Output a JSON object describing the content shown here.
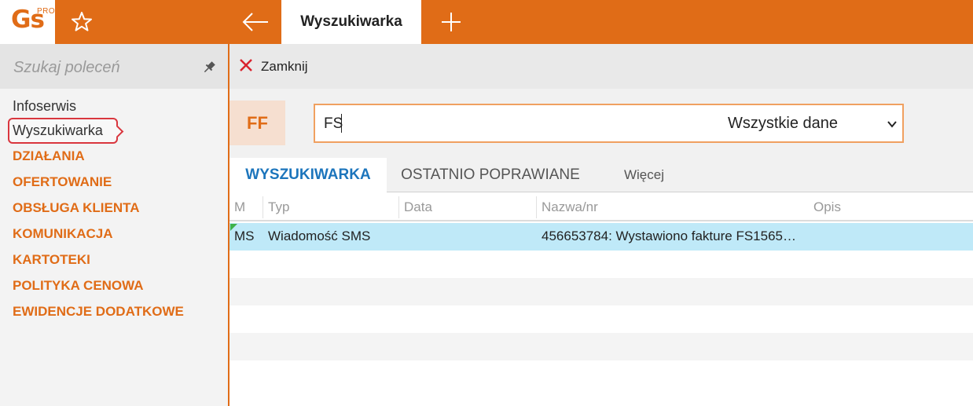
{
  "topbar": {
    "logo_text": "Gs",
    "logo_superscript": "PRO",
    "active_tab": "Wyszukiwarka",
    "accent_color": "#e06c17"
  },
  "sidebar": {
    "search_placeholder": "Szukaj poleceń",
    "items": [
      {
        "label": "Infoserwis"
      },
      {
        "label": "Wyszukiwarka"
      }
    ],
    "categories": [
      {
        "label": "DZIAŁANIA"
      },
      {
        "label": "OFERTOWANIE"
      },
      {
        "label": "OBSŁUGA KLIENTA"
      },
      {
        "label": "KOMUNIKACJA"
      },
      {
        "label": "KARTOTEKI"
      },
      {
        "label": "POLITYKA CENOWA"
      },
      {
        "label": "EWIDENCJE DODATKOWE"
      }
    ]
  },
  "toolbar": {
    "close_label": "Zamknij"
  },
  "search": {
    "badge": "FF",
    "value": "FS",
    "scope_selected": "Wszystkie dane"
  },
  "tabs": [
    {
      "label": "WYSZUKIWARKA"
    },
    {
      "label": "OSTATNIO POPRAWIANE"
    },
    {
      "label": "Więcej"
    }
  ],
  "grid": {
    "columns": [
      "M",
      "Typ",
      "Data",
      "Nazwa/nr",
      "Opis"
    ],
    "rows": [
      {
        "m": "MS",
        "typ": "Wiadomość SMS",
        "data": "",
        "nazwa": "456653784: Wystawiono fakture FS1565…",
        "opis": ""
      }
    ]
  }
}
